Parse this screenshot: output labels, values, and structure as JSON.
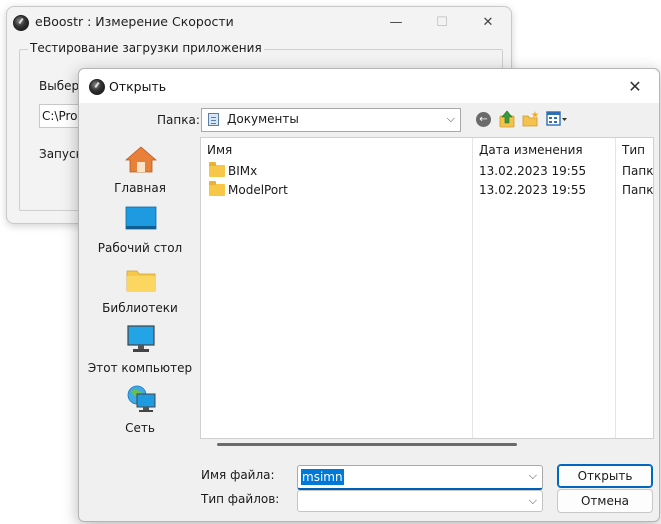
{
  "bg_window": {
    "title": "eBoostr : Измерение Скорости",
    "minimize": "—",
    "maximize": "☐",
    "close": "✕",
    "group_title": "Тестирование загрузки приложения",
    "label_select": "Выберит",
    "path_value": "C:\\Progr",
    "label_run": "Запуска"
  },
  "dialog": {
    "title": "Открыть",
    "close": "✕",
    "folder_label": "Папка:",
    "folder_value": "Документы",
    "chevron": "⌵",
    "back_glyph": "←",
    "places": [
      {
        "label": "Главная",
        "icon": "home-icon"
      },
      {
        "label": "Рабочий стол",
        "icon": "desktop-icon"
      },
      {
        "label": "Библиотеки",
        "icon": "libraries-icon"
      },
      {
        "label": "Этот компьютер",
        "icon": "computer-icon"
      },
      {
        "label": "Сеть",
        "icon": "network-icon"
      }
    ],
    "columns": {
      "name": "Имя",
      "date": "Дата изменения",
      "type": "Тип"
    },
    "sort_arrow": "^",
    "files": [
      {
        "name": "BIMx",
        "date": "13.02.2023 19:55",
        "type": "Папк"
      },
      {
        "name": "ModelPort",
        "date": "13.02.2023 19:55",
        "type": "Папк"
      }
    ],
    "filename_label": "Имя файла:",
    "filename_value": "msimn",
    "filetype_label": "Тип файлов:",
    "filetype_value": "",
    "open_button": "Открыть",
    "cancel_button": "Отмена"
  }
}
